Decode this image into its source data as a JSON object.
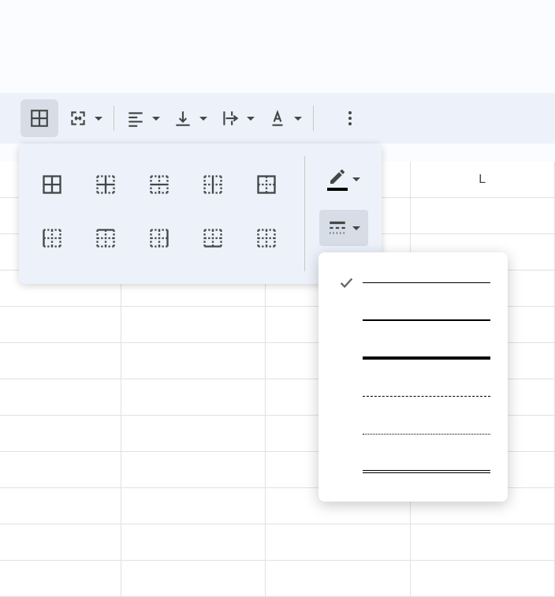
{
  "toolbar": {
    "borders_tool": "borders",
    "merge_tool": "merge",
    "halign_tool": "halign",
    "valign_tool": "valign",
    "wrap_tool": "wrap",
    "textcolor_tool": "textcolor",
    "more_tool": "more"
  },
  "columns": [
    "",
    "",
    "",
    "L"
  ],
  "borders": {
    "options": [
      "border-all",
      "border-inner",
      "border-horizontal",
      "border-vertical",
      "border-outer",
      "border-left",
      "border-top",
      "border-right",
      "border-bottom",
      "border-none"
    ],
    "color_tool": "border-color",
    "style_tool": "border-style"
  },
  "border_styles": {
    "selected_index": 0,
    "items": [
      "thin",
      "medium",
      "thick",
      "dashed",
      "dotted",
      "double"
    ]
  }
}
